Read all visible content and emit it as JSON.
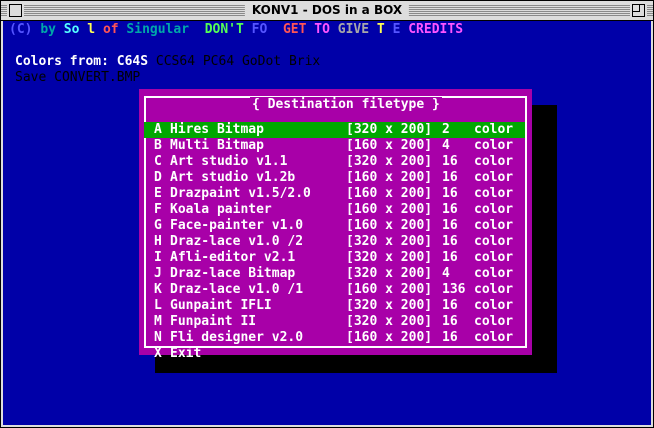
{
  "window": {
    "title": "KONV1 - DOS in a BOX"
  },
  "credits": [
    {
      "text": "(C) ",
      "color": "#5555ff"
    },
    {
      "text": "by ",
      "color": "#00a8a8"
    },
    {
      "text": "So",
      "color": "#55ffff"
    },
    {
      "text": " ",
      "color": "#ffffff"
    },
    {
      "text": "l ",
      "color": "#ffff55"
    },
    {
      "text": "of ",
      "color": "#ff5555"
    },
    {
      "text": "Singular  ",
      "color": "#00a8a8"
    },
    {
      "text": "DON'T ",
      "color": "#55ff55"
    },
    {
      "text": "FO",
      "color": "#5555ff"
    },
    {
      "text": "  ",
      "color": "#ffffff"
    },
    {
      "text": "GET ",
      "color": "#ff5555"
    },
    {
      "text": "TO ",
      "color": "#ff55ff"
    },
    {
      "text": "GIVE ",
      "color": "#a8a8a8"
    },
    {
      "text": "T ",
      "color": "#ffff55"
    },
    {
      "text": "E ",
      "color": "#5555ff"
    },
    {
      "text": "CREDITS",
      "color": "#ff55ff"
    }
  ],
  "colors_line": {
    "label": "Colors from:",
    "selected": "C64S",
    "others": "CCS64 PC64 GoDot Brix",
    "label_color": "#ffffff",
    "others_color": "#000000"
  },
  "save_line": "Save CONVERT.BMP",
  "dialog": {
    "title": "{ Destination filetype }",
    "selected_index": 0,
    "items": [
      {
        "key": "A",
        "name": "Hires Bitmap",
        "res": "[320 x 200]",
        "colors": "2",
        "unit": "color"
      },
      {
        "key": "B",
        "name": "Multi Bitmap",
        "res": "[160 x 200]",
        "colors": "4",
        "unit": "color"
      },
      {
        "key": "C",
        "name": "Art studio v1.1",
        "res": "[320 x 200]",
        "colors": "16",
        "unit": "color"
      },
      {
        "key": "D",
        "name": "Art studio v1.2b",
        "res": "[160 x 200]",
        "colors": "16",
        "unit": "color"
      },
      {
        "key": "E",
        "name": "Drazpaint v1.5/2.0",
        "res": "[160 x 200]",
        "colors": "16",
        "unit": "color"
      },
      {
        "key": "F",
        "name": "Koala painter",
        "res": "[160 x 200]",
        "colors": "16",
        "unit": "color"
      },
      {
        "key": "G",
        "name": "Face-painter v1.0",
        "res": "[160 x 200]",
        "colors": "16",
        "unit": "color"
      },
      {
        "key": "H",
        "name": "Draz-lace v1.0 /2",
        "res": "[320 x 200]",
        "colors": "16",
        "unit": "color"
      },
      {
        "key": "I",
        "name": "Afli-editor v2.1",
        "res": "[320 x 200]",
        "colors": "16",
        "unit": "color"
      },
      {
        "key": "J",
        "name": "Draz-lace Bitmap",
        "res": "[320 x 200]",
        "colors": "4",
        "unit": "color"
      },
      {
        "key": "K",
        "name": "Draz-lace v1.0 /1",
        "res": "[160 x 200]",
        "colors": "136",
        "unit": "color"
      },
      {
        "key": "L",
        "name": "Gunpaint IFLI",
        "res": "[320 x 200]",
        "colors": "16",
        "unit": "color"
      },
      {
        "key": "M",
        "name": "Funpaint II",
        "res": "[320 x 200]",
        "colors": "16",
        "unit": "color"
      },
      {
        "key": "N",
        "name": "Fli designer v2.0",
        "res": "[160 x 200]",
        "colors": "16",
        "unit": "color"
      },
      {
        "key": "X",
        "name": "Exit",
        "res": "",
        "colors": "",
        "unit": ""
      }
    ]
  }
}
